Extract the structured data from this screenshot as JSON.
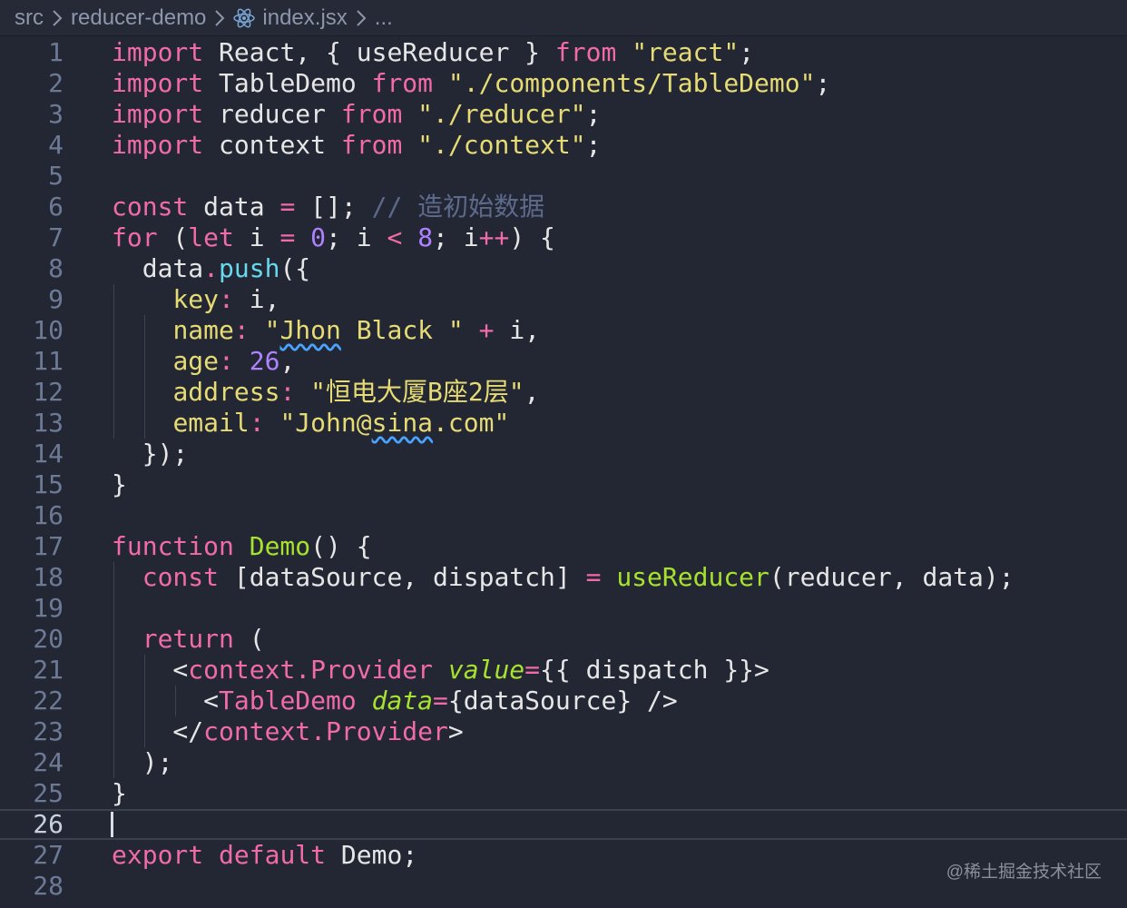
{
  "breadcrumb": {
    "parts": [
      "src",
      "reducer-demo",
      "index.jsx",
      "..."
    ]
  },
  "active_line": "26",
  "line_numbers": [
    "1",
    "2",
    "3",
    "4",
    "5",
    "6",
    "7",
    "8",
    "9",
    "10",
    "11",
    "12",
    "13",
    "14",
    "15",
    "16",
    "17",
    "18",
    "19",
    "20",
    "21",
    "22",
    "23",
    "24",
    "25",
    "26",
    "27",
    "28"
  ],
  "code": {
    "l1": {
      "t1": "import",
      "t2": " React, { useReducer } ",
      "t3": "from",
      "t4": " ",
      "t5": "\"react\"",
      "t6": ";"
    },
    "l2": {
      "t1": "import",
      "t2": " TableDemo ",
      "t3": "from",
      "t4": " ",
      "t5": "\"./components/TableDemo\"",
      "t6": ";"
    },
    "l3": {
      "t1": "import",
      "t2": " reducer ",
      "t3": "from",
      "t4": " ",
      "t5": "\"./reducer\"",
      "t6": ";"
    },
    "l4": {
      "t1": "import",
      "t2": " context ",
      "t3": "from",
      "t4": " ",
      "t5": "\"./context\"",
      "t6": ";"
    },
    "l6": {
      "t1": "const",
      "t2": " data ",
      "t3": "=",
      "t4": " []; ",
      "t5": "// 造初始数据"
    },
    "l7": {
      "t1": "for",
      "t2": " (",
      "t3": "let",
      "t4": " i ",
      "t5": "=",
      "t6": " ",
      "t7": "0",
      "t8": "; i ",
      "t9": "<",
      "t10": " ",
      "t11": "8",
      "t12": "; i",
      "t13": "++",
      "t14": ") {"
    },
    "l8": {
      "t1": "  data",
      "t2": ".",
      "t3": "push",
      "t4": "({"
    },
    "l9": {
      "t1": "    ",
      "t2": "key",
      "t3": ":",
      "t4": " i,"
    },
    "l10": {
      "t1": "    ",
      "t2": "name",
      "t3": ":",
      "t4": " ",
      "t5": "\"",
      "t6": "Jhon",
      "t7": " Black \"",
      "t8": " ",
      "t9": "+",
      "t10": " i,"
    },
    "l11": {
      "t1": "    ",
      "t2": "age",
      "t3": ":",
      "t4": " ",
      "t5": "26",
      "t6": ","
    },
    "l12": {
      "t1": "    ",
      "t2": "address",
      "t3": ":",
      "t4": " ",
      "t5": "\"恒电大厦B座2层\"",
      "t6": ","
    },
    "l13": {
      "t1": "    ",
      "t2": "email",
      "t3": ":",
      "t4": " ",
      "t5": "\"John@",
      "t6": "sina",
      "t7": ".com\""
    },
    "l14": {
      "t1": "  });"
    },
    "l15": {
      "t1": "}"
    },
    "l17": {
      "t1": "function",
      "t2": " ",
      "t3": "Demo",
      "t4": "() {"
    },
    "l18": {
      "t1": "  ",
      "t2": "const",
      "t3": " [dataSource, dispatch] ",
      "t4": "=",
      "t5": " ",
      "t6": "useReducer",
      "t7": "(reducer, data);"
    },
    "l20": {
      "t1": "  ",
      "t2": "return",
      "t3": " ("
    },
    "l21": {
      "t1": "    <",
      "t2": "context.Provider",
      "t3": " ",
      "t4": "value",
      "t5": "=",
      "t6": "{{ dispatch }}>"
    },
    "l22": {
      "t1": "      <",
      "t2": "TableDemo",
      "t3": " ",
      "t4": "data",
      "t5": "=",
      "t6": "{dataSource} />"
    },
    "l23": {
      "t1": "    </",
      "t2": "context.Provider",
      "t3": ">"
    },
    "l24": {
      "t1": "  );"
    },
    "l25": {
      "t1": "}"
    },
    "l27": {
      "t1": "export",
      "t2": " ",
      "t3": "default",
      "t4": " Demo;"
    }
  },
  "watermark": "@稀土掘金技术社区",
  "colors": {
    "background": "#232733",
    "keyword": "#f06ba8",
    "string": "#e6db74",
    "function": "#a6e22e",
    "number": "#ae81ff",
    "property": "#66d9ef",
    "comment": "#5d6a8c"
  }
}
